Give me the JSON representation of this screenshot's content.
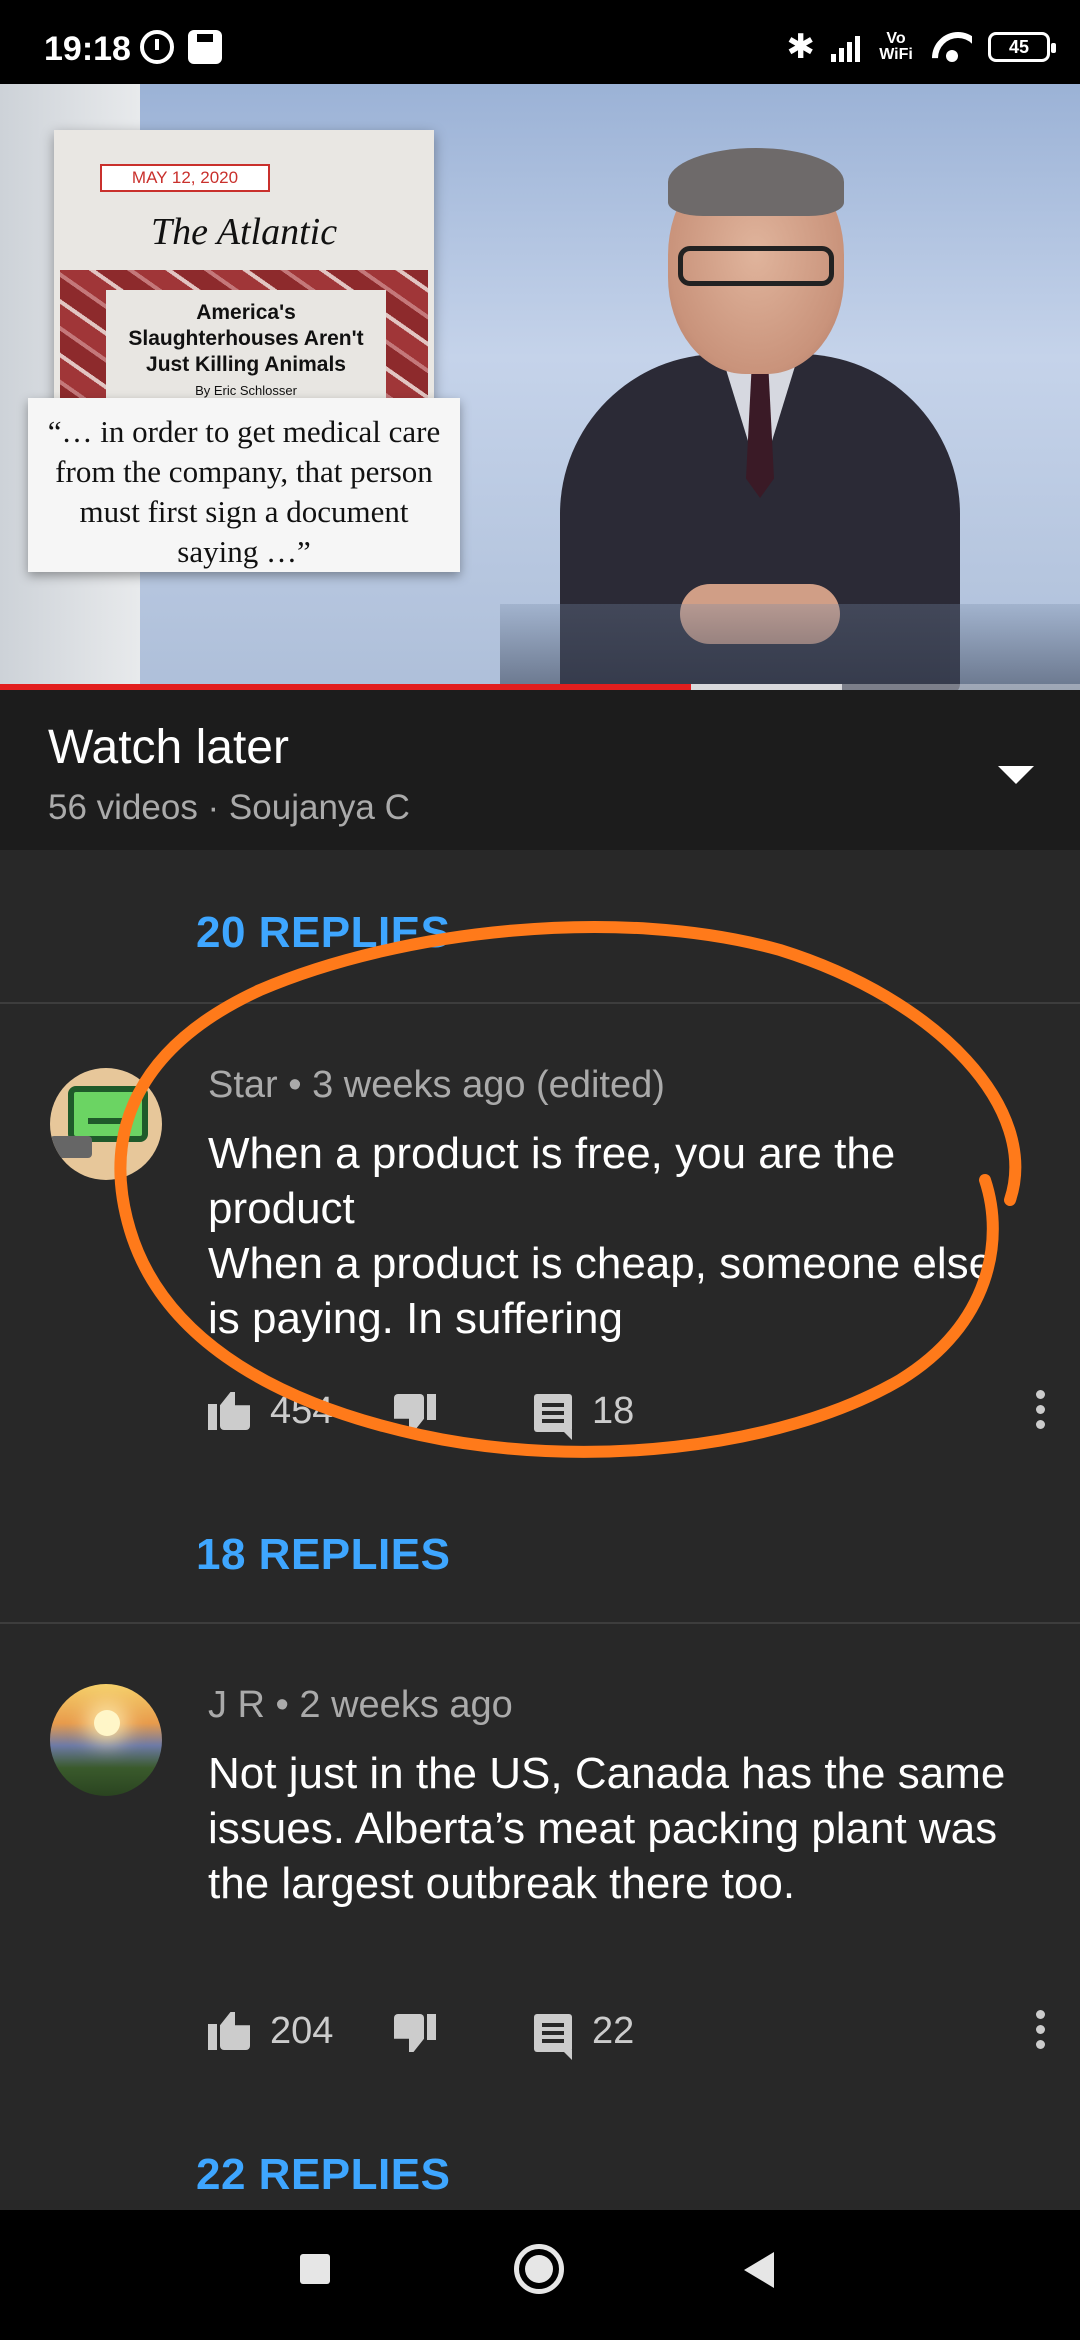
{
  "status_bar": {
    "time": "19:18",
    "battery": "45",
    "vowifi": "Vo WiFi"
  },
  "video": {
    "progress_fraction": 0.64,
    "buffered_fraction": 0.78,
    "article": {
      "date": "MAY 12, 2020",
      "publication": "The Atlantic",
      "headline": "America's Slaughterhouses Aren't Just Killing Animals",
      "author": "By Eric Schlosser",
      "quote": "“… in order to get medical care from the company, that person must first sign a document saying …”"
    }
  },
  "playlist": {
    "title": "Watch later",
    "subtitle": "56 videos · Soujanya C"
  },
  "comments": {
    "top_replies_label": "20 REPLIES",
    "items": [
      {
        "author_meta": "Star • 3 weeks ago (edited)",
        "text": "When a product is free, you are the product\nWhen a product is cheap, someone else is paying. In suffering",
        "likes": "454",
        "reply_count": "18",
        "replies_label": "18 REPLIES"
      },
      {
        "author_meta": "J R • 2 weeks ago",
        "text": "Not just in the US, Canada has the same issues. Alberta’s meat packing plant was the largest outbreak there too.",
        "likes": "204",
        "reply_count": "22",
        "replies_label": "22 REPLIES"
      }
    ]
  },
  "colors": {
    "background": "#282828",
    "header_bg": "#1c1c1c",
    "link_blue": "#3ea6ff",
    "progress_red": "#e21e1e",
    "annotation_orange": "#ff7a1a"
  }
}
